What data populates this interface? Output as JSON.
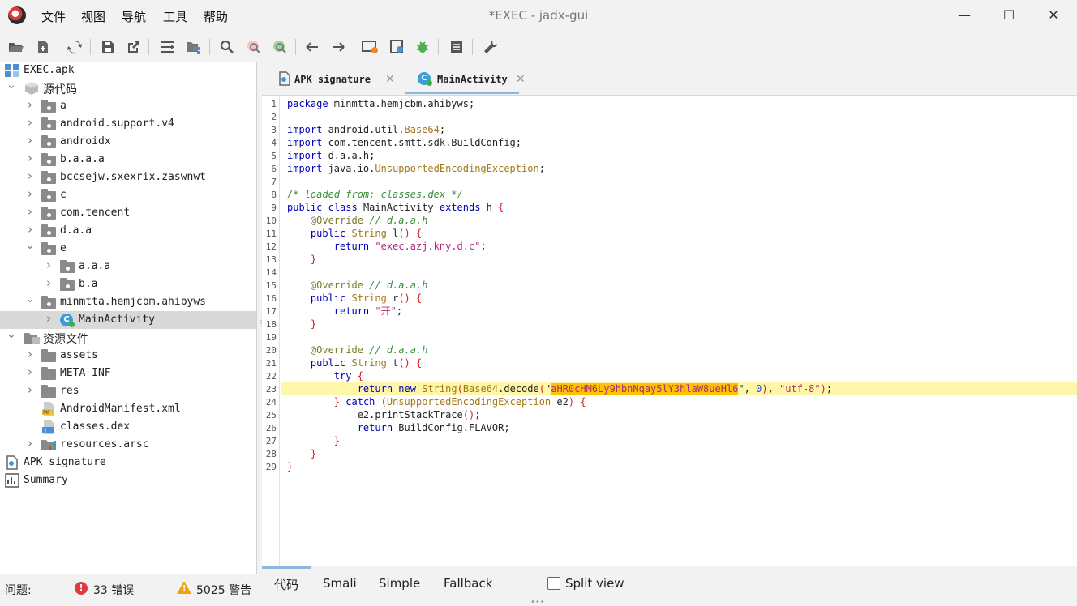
{
  "window": {
    "title": "*EXEC - jadx-gui",
    "minimize": "—",
    "maximize": "☐",
    "close": "✕"
  },
  "menu": [
    "文件",
    "视图",
    "导航",
    "工具",
    "帮助"
  ],
  "toolbar": {
    "items": [
      "open-file-icon",
      "add-file-icon",
      "sync-icon",
      "save-icon",
      "export-icon",
      "flatten-icon",
      "package-icon",
      "search-icon",
      "search-class-icon",
      "search-usage-icon",
      "back-icon",
      "forward-icon",
      "deobfuscation-icon",
      "quark-icon",
      "debug-icon",
      "log-icon",
      "preferences-icon"
    ]
  },
  "tree": {
    "items": [
      {
        "label": "EXEC.apk",
        "icon": "apk-icon",
        "level": 0,
        "expander": "none"
      },
      {
        "label": "源代码",
        "icon": "source-icon",
        "level": 0,
        "expander": "open"
      },
      {
        "label": "a",
        "icon": "package-icon",
        "level": 1,
        "expander": "closed"
      },
      {
        "label": "android.support.v4",
        "icon": "package-icon",
        "level": 1,
        "expander": "closed"
      },
      {
        "label": "androidx",
        "icon": "package-icon",
        "level": 1,
        "expander": "closed"
      },
      {
        "label": "b.a.a.a",
        "icon": "package-icon",
        "level": 1,
        "expander": "closed"
      },
      {
        "label": "bccsejw.sxexrix.zaswnwt",
        "icon": "package-icon",
        "level": 1,
        "expander": "closed"
      },
      {
        "label": "c",
        "icon": "package-icon",
        "level": 1,
        "expander": "closed"
      },
      {
        "label": "com.tencent",
        "icon": "package-icon",
        "level": 1,
        "expander": "closed"
      },
      {
        "label": "d.a.a",
        "icon": "package-icon",
        "level": 1,
        "expander": "closed"
      },
      {
        "label": "e",
        "icon": "package-icon",
        "level": 1,
        "expander": "open"
      },
      {
        "label": "a.a.a",
        "icon": "package-icon",
        "level": 2,
        "expander": "closed"
      },
      {
        "label": "b.a",
        "icon": "package-icon",
        "level": 2,
        "expander": "closed"
      },
      {
        "label": "minmtta.hemjcbm.ahibyws",
        "icon": "package-icon",
        "level": 1,
        "expander": "open"
      },
      {
        "label": "MainActivity",
        "icon": "class-icon",
        "level": 2,
        "expander": "closed",
        "selected": true
      },
      {
        "label": "资源文件",
        "icon": "resources-icon",
        "level": 0,
        "expander": "open"
      },
      {
        "label": "assets",
        "icon": "folder-icon",
        "level": 1,
        "expander": "closed"
      },
      {
        "label": "META-INF",
        "icon": "folder-icon",
        "level": 1,
        "expander": "closed"
      },
      {
        "label": "res",
        "icon": "folder-icon",
        "level": 1,
        "expander": "closed"
      },
      {
        "label": "AndroidManifest.xml",
        "icon": "manifest-icon",
        "level": 1,
        "expander": "none"
      },
      {
        "label": "classes.dex",
        "icon": "dex-icon",
        "level": 1,
        "expander": "none"
      },
      {
        "label": "resources.arsc",
        "icon": "arsc-icon",
        "level": 1,
        "expander": "closed"
      },
      {
        "label": "APK signature",
        "icon": "signature-icon",
        "level": 0,
        "expander": "none"
      },
      {
        "label": "Summary",
        "icon": "summary-icon",
        "level": 0,
        "expander": "none"
      }
    ]
  },
  "tabs": [
    {
      "label": "APK signature",
      "icon": "signature-icon",
      "active": false
    },
    {
      "label": "MainActivity",
      "icon": "class-icon",
      "active": true
    }
  ],
  "code": {
    "highlighted_line": 23,
    "lines": [
      "package minmtta.hemjcbm.ahibyws;",
      "",
      "import android.util.Base64;",
      "import com.tencent.smtt.sdk.BuildConfig;",
      "import d.a.a.h;",
      "import java.io.UnsupportedEncodingException;",
      "",
      "/* loaded from: classes.dex */",
      "public class MainActivity extends h {",
      "    @Override // d.a.a.h",
      "    public String l() {",
      "        return \"exec.azj.kny.d.c\";",
      "    }",
      "",
      "    @Override // d.a.a.h",
      "    public String r() {",
      "        return \"开\";",
      "    }",
      "",
      "    @Override // d.a.a.h",
      "    public String t() {",
      "        try {",
      "            return new String(Base64.decode(\"aHR0cHM6Ly9hbnNqay5lY3hlaW8ueHl6\", 0), \"utf-8\");",
      "        } catch (UnsupportedEncodingException e2) {",
      "            e2.printStackTrace();",
      "            return BuildConfig.FLAVOR;",
      "        }",
      "    }",
      "}"
    ]
  },
  "view_tabs": {
    "items": [
      "代码",
      "Smali",
      "Simple",
      "Fallback"
    ],
    "split_view": "Split view",
    "split_checked": false
  },
  "status": {
    "problems_label": "问题:",
    "errors": "33 错误",
    "warnings": "5025 警告"
  },
  "colors": {
    "keyword": "#0000b8",
    "string": "#b02a7a",
    "type": "#a0781a",
    "comment": "#3c8c3c",
    "highlight": "#fff7a8",
    "match": "#ffc400"
  }
}
